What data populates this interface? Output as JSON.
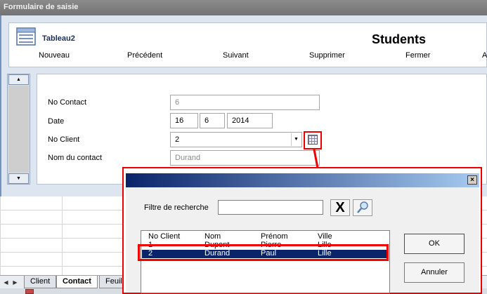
{
  "form": {
    "title": "Formulaire de saisie",
    "table_name": "Tableau2",
    "sheet_title": "Students",
    "nav_buttons": [
      "Nouveau",
      "Précédent",
      "Suivant",
      "Supprimer",
      "Fermer",
      "A"
    ],
    "fields": {
      "no_contact": {
        "label": "No Contact",
        "value": "6"
      },
      "date": {
        "label": "Date",
        "day": "16",
        "month": "6",
        "year": "2014"
      },
      "no_client": {
        "label": "No Client",
        "value": "2"
      },
      "nom_contact": {
        "label": "Nom du contact",
        "value": "Durand"
      }
    },
    "scroll": {
      "up": "▲",
      "down": "▼"
    }
  },
  "excel": {
    "sheet_tabs": [
      "Client",
      "Contact",
      "Feuil"
    ],
    "active_tab": "Contact"
  },
  "dialog": {
    "close_label": "×",
    "filter_label": "Filtre de recherche",
    "filter_value": "",
    "clear_label": "X",
    "columns": [
      "No Client",
      "Nom",
      "Prénom",
      "Ville"
    ],
    "rows": [
      [
        "1",
        "Dupont",
        "Pierre",
        "Lille"
      ],
      [
        "2",
        "Durand",
        "Paul",
        "Lille"
      ]
    ],
    "selected_row": 1,
    "ok_label": "OK",
    "cancel_label": "Annuler"
  },
  "colors": {
    "highlight": "#ee0000",
    "selection": "#0a246a",
    "form_frame": "#7295c2"
  }
}
